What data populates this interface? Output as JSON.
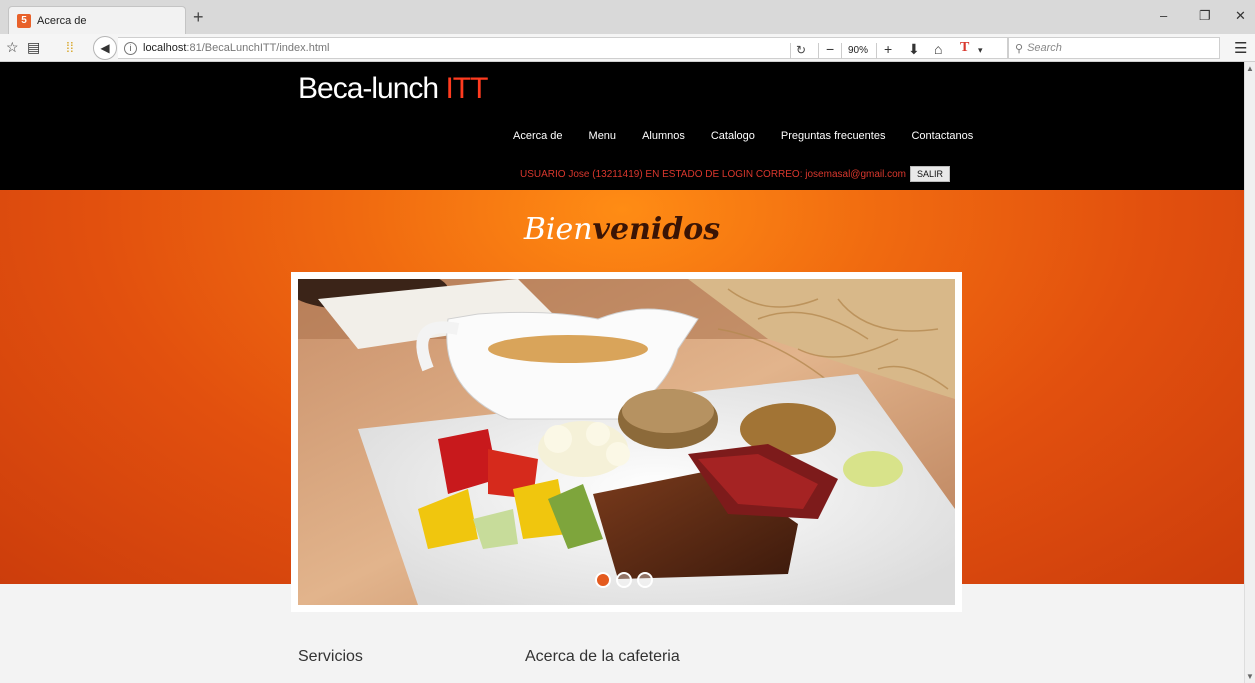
{
  "browser": {
    "tab_title": "Acerca de",
    "tab_favicon": "html-icon",
    "new_tab_label": "+",
    "url_host": "localhost",
    "url_path": ":81/BecaLunchITT/index.html",
    "zoom_level": "90%",
    "zoom_minus": "−",
    "zoom_plus": "+",
    "search_placeholder": "Search",
    "window_minimize": "–",
    "window_restore": "❐",
    "window_close": "✕"
  },
  "site": {
    "logo_main": "Beca-lunch ",
    "logo_accent": "ITT",
    "accent_color": "#ff3b1f",
    "nav": [
      "Acerca de",
      "Menu",
      "Alumnos",
      "Catalogo",
      "Preguntas frecuentes",
      "Contactanos"
    ],
    "login_text": "USUARIO Jose (13211419) EN ESTADO DE LOGIN CORREO: josemasal@gmail.com",
    "logout_label": "SALIR"
  },
  "hero": {
    "title_part1": "Bien",
    "title_part2": "venidos",
    "slider_count": 3,
    "active_slide": 1
  },
  "sections": {
    "services": "Servicios",
    "about": "Acerca de la cafeteria"
  }
}
